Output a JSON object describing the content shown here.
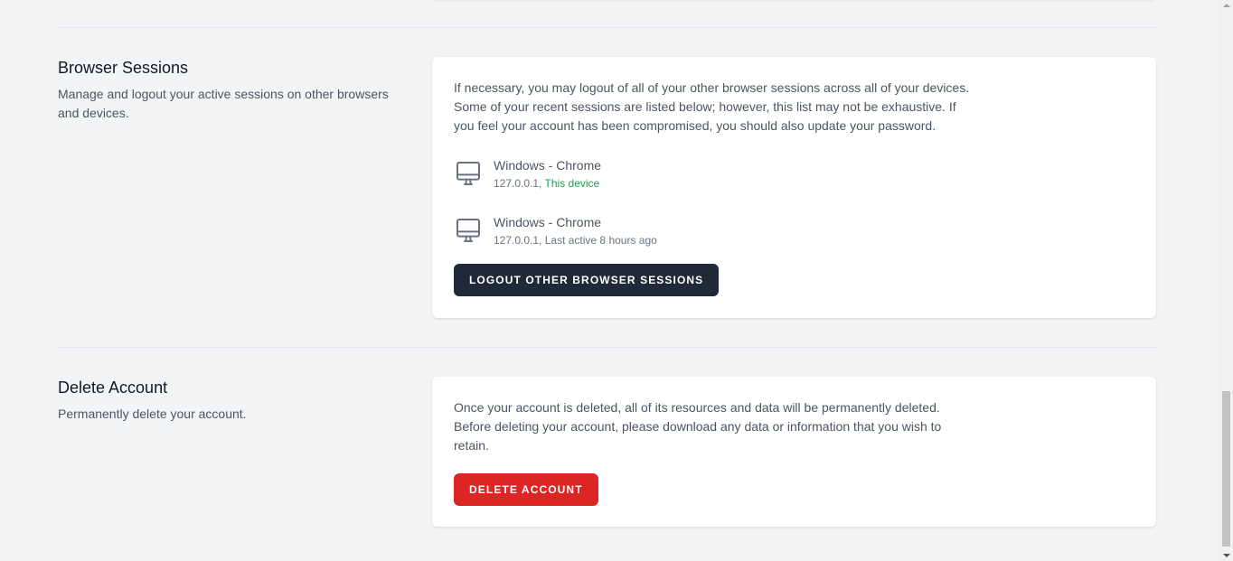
{
  "browser_sessions": {
    "title": "Browser Sessions",
    "description": "Manage and logout your active sessions on other browsers and devices.",
    "info_text": "If necessary, you may logout of all of your other browser sessions across all of your devices. Some of your recent sessions are listed below; however, this list may not be exhaustive. If you feel your account has been compromised, you should also update your password.",
    "sessions": [
      {
        "device": "Windows - Chrome",
        "ip": "127.0.0.1,",
        "status": "This device",
        "icon": "desktop-icon"
      },
      {
        "device": "Windows - Chrome",
        "ip": "127.0.0.1,",
        "status": "Last active 8 hours ago",
        "icon": "desktop-icon"
      }
    ],
    "logout_button": "LOGOUT OTHER BROWSER SESSIONS"
  },
  "delete_account": {
    "title": "Delete Account",
    "description": "Permanently delete your account.",
    "info_text": "Once your account is deleted, all of its resources and data will be permanently deleted. Before deleting your account, please download any data or information that you wish to retain.",
    "delete_button": "DELETE ACCOUNT"
  },
  "colors": {
    "background": "#f3f4f6",
    "card": "#ffffff",
    "dark_button": "#1f2937",
    "danger_button": "#dc2626",
    "this_device": "#16a34a"
  }
}
